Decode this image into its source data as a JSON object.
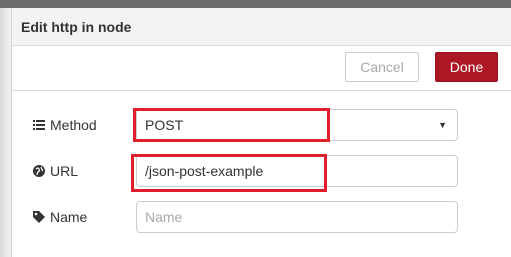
{
  "dialog": {
    "title": "Edit http in node"
  },
  "toolbar": {
    "cancel_label": "Cancel",
    "done_label": "Done"
  },
  "form": {
    "method": {
      "label": "Method",
      "value": "POST",
      "icon": "list-icon"
    },
    "url": {
      "label": "URL",
      "value": "/json-post-example",
      "icon": "globe-icon"
    },
    "name": {
      "label": "Name",
      "value": "",
      "placeholder": "Name",
      "icon": "tag-icon"
    }
  },
  "colors": {
    "done_bg": "#ad1625",
    "highlight": "#e01e2c",
    "header_bg": "#f3f3f3"
  }
}
